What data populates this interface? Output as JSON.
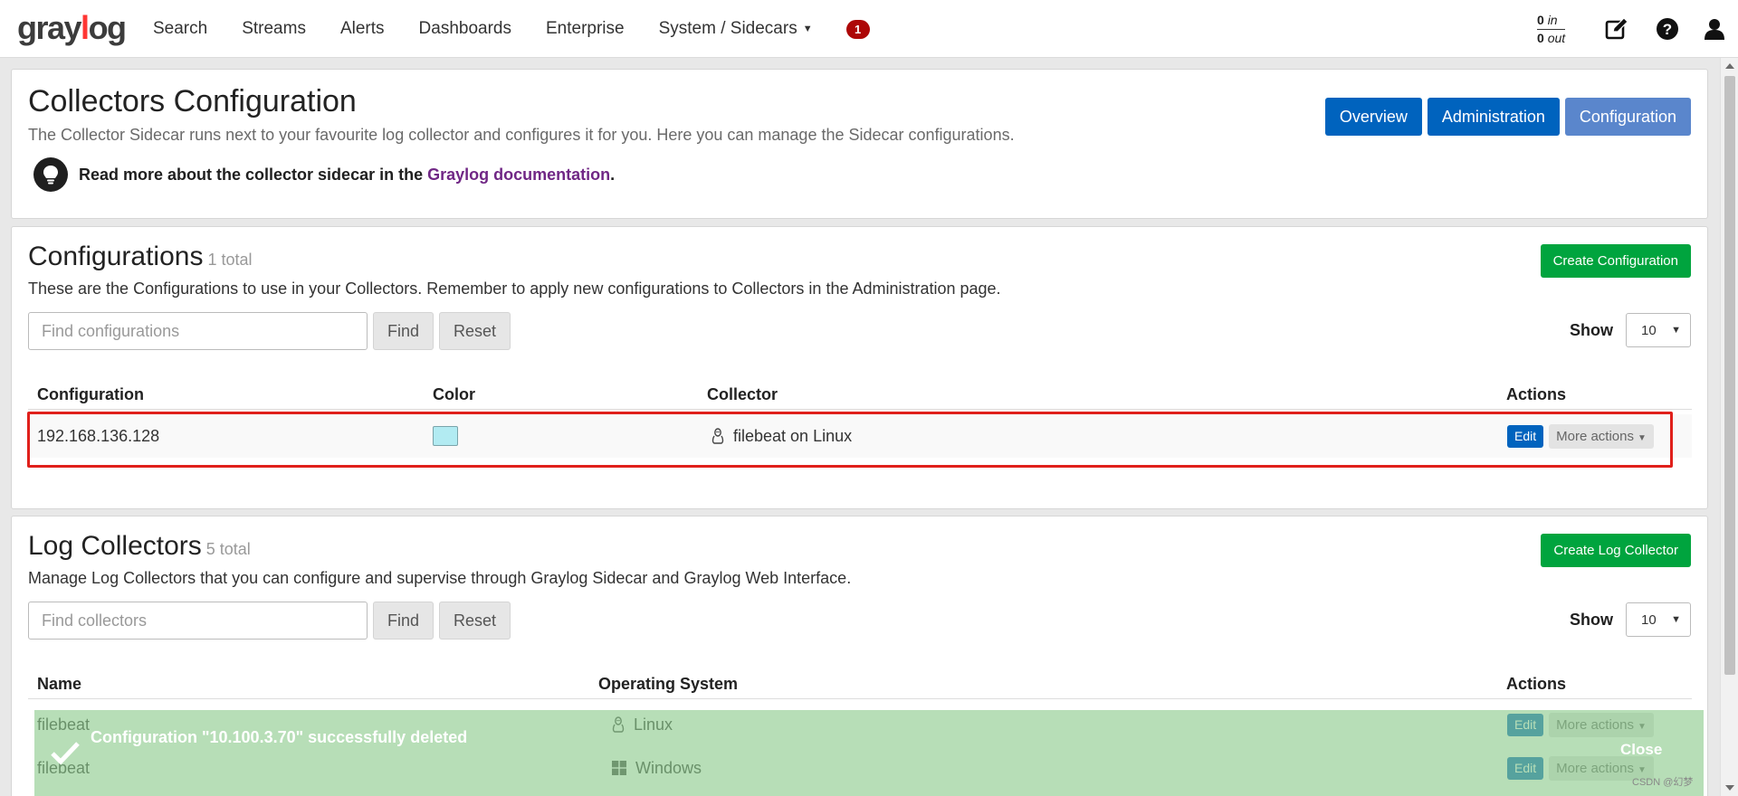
{
  "nav": {
    "logo": "graylog",
    "items": [
      "Search",
      "Streams",
      "Alerts",
      "Dashboards",
      "Enterprise",
      "System / Sidecars"
    ],
    "notification_count": "1",
    "throughput": {
      "in_count": "0",
      "in_label": "in",
      "out_count": "0",
      "out_label": "out"
    },
    "icons": [
      "edit-icon",
      "help-icon",
      "user-icon"
    ]
  },
  "header": {
    "title": "Collectors Configuration",
    "subtitle": "The Collector Sidecar runs next to your favourite log collector and configures it for you. Here you can manage the Sidecar configurations.",
    "doc_prefix": "Read more about the collector sidecar in the ",
    "doc_link": "Graylog documentation",
    "doc_suffix": ".",
    "tabs": [
      "Overview",
      "Administration",
      "Configuration"
    ],
    "active_tab": "Configuration"
  },
  "configurations": {
    "title": "Configurations",
    "count": "1 total",
    "description": "These are the Configurations to use in your Collectors. Remember to apply new configurations to Collectors in the Administration page.",
    "create_label": "Create Configuration",
    "search_placeholder": "Find configurations",
    "find_label": "Find",
    "reset_label": "Reset",
    "show_label": "Show",
    "page_size": "10",
    "columns": [
      "Configuration",
      "Color",
      "Collector",
      "Actions"
    ],
    "rows": [
      {
        "name": "192.168.136.128",
        "color": "#b2ebf2",
        "collector": "filebeat on Linux",
        "os_icon": "linux-icon",
        "edit": "Edit",
        "more": "More actions"
      }
    ]
  },
  "collectors": {
    "title": "Log Collectors",
    "count": "5 total",
    "description": "Manage Log Collectors that you can configure and supervise through Graylog Sidecar and Graylog Web Interface.",
    "create_label": "Create Log Collector",
    "search_placeholder": "Find collectors",
    "find_label": "Find",
    "reset_label": "Reset",
    "show_label": "Show",
    "page_size": "10",
    "columns": [
      "Name",
      "Operating System",
      "Actions"
    ],
    "rows": [
      {
        "name": "filebeat",
        "os": "Linux",
        "os_icon": "linux-icon",
        "edit": "Edit",
        "more": "More actions"
      },
      {
        "name": "filebeat",
        "os": "Windows",
        "os_icon": "windows-icon",
        "edit": "Edit",
        "more": "More actions"
      }
    ]
  },
  "toast": {
    "message": "Configuration \"10.100.3.70\" successfully deleted",
    "close_label": "Close"
  },
  "watermark": "CSDN @幻梦"
}
